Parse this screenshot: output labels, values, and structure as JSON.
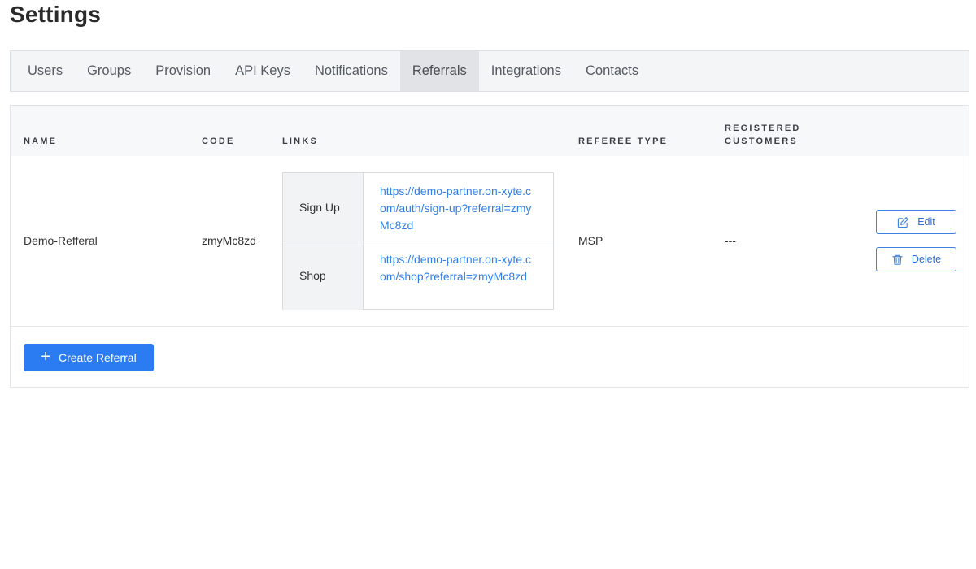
{
  "page": {
    "title": "Settings"
  },
  "tabs": [
    {
      "label": "Users",
      "active": false
    },
    {
      "label": "Groups",
      "active": false
    },
    {
      "label": "Provision",
      "active": false
    },
    {
      "label": "API Keys",
      "active": false
    },
    {
      "label": "Notifications",
      "active": false
    },
    {
      "label": "Referrals",
      "active": true
    },
    {
      "label": "Integrations",
      "active": false
    },
    {
      "label": "Contacts",
      "active": false
    }
  ],
  "table": {
    "headers": {
      "name": "NAME",
      "code": "CODE",
      "links": "LINKS",
      "referee_type": "REFEREE TYPE",
      "registered_customers_line1": "REGISTERED",
      "registered_customers_line2": "CUSTOMERS"
    },
    "rows": [
      {
        "name": "Demo-Refferal",
        "code": "zmyMc8zd",
        "links": [
          {
            "label": "Sign Up",
            "url": "https://demo-partner.on-xyte.com/auth/sign-up?referral=zmyMc8zd"
          },
          {
            "label": "Shop",
            "url": "https://demo-partner.on-xyte.com/shop?referral=zmyMc8zd"
          }
        ],
        "referee_type": "MSP",
        "registered_customers": "---",
        "edit_label": "Edit",
        "delete_label": "Delete"
      }
    ]
  },
  "actions": {
    "create_label": "Create Referral"
  },
  "colors": {
    "accent": "#2b7bf2",
    "link": "#2f7fe6",
    "outline": "#3d83df"
  }
}
